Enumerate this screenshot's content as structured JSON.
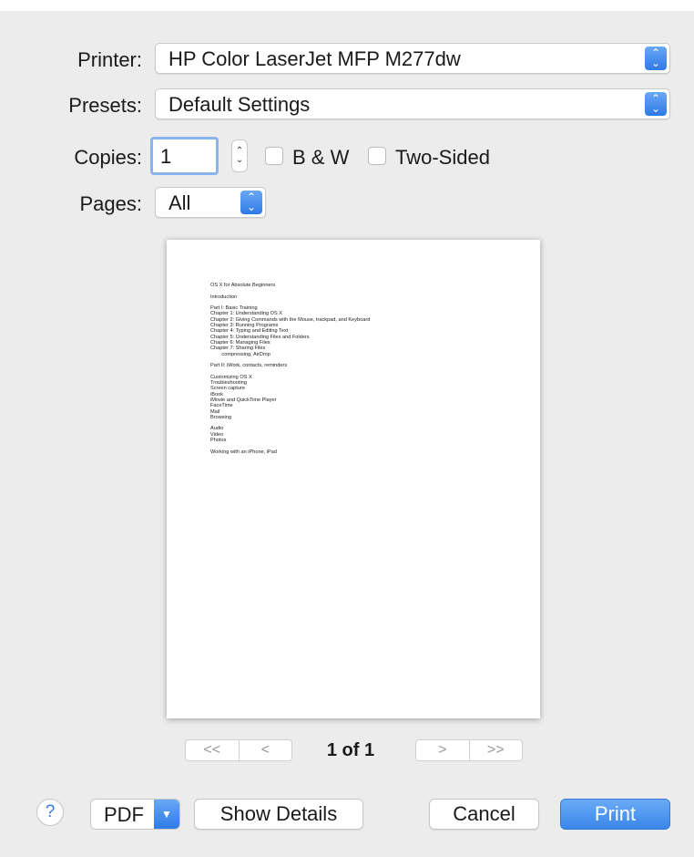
{
  "printer": {
    "label": "Printer:",
    "value": "HP Color LaserJet MFP M277dw"
  },
  "presets": {
    "label": "Presets:",
    "value": "Default Settings"
  },
  "copies": {
    "label": "Copies:",
    "value": "1"
  },
  "bw": {
    "label": "B & W",
    "checked": false
  },
  "two_sided": {
    "label": "Two-Sided",
    "checked": false
  },
  "pages": {
    "label": "Pages:",
    "value": "All"
  },
  "preview": {
    "lines": [
      "OS X for Absolute Beginners",
      "",
      "Introduction",
      "",
      "Part I: Basic Training",
      "Chapter 1: Understanding OS X",
      "Chapter 2: Giving Commands with the Mouse, trackpad, and Keyboard",
      "Chapter 3: Running Programs",
      "Chapter 4: Typing and Editing Text",
      "Chapter 5: Understanding Files and Folders",
      "Chapter 6: Managing Files",
      "Chapter 7: Sharing Files",
      "        compressing, AirDrop",
      "",
      "Part II: iWork, contacts, reminders",
      "",
      "Customizing OS X",
      "Troubleshooting",
      "Screen capture",
      "iBook",
      "iMovie and QuickTime Player",
      "FaceTime",
      "Mail",
      "Browsing",
      "",
      "Audio",
      "Video",
      "Photos",
      "",
      "Working with an iPhone, iPad"
    ]
  },
  "nav": {
    "first": "<<",
    "prev": "<",
    "next": ">",
    "last": ">>",
    "page_indicator": "1 of 1"
  },
  "bottom": {
    "help": "?",
    "pdf": "PDF",
    "show_details": "Show Details",
    "cancel": "Cancel",
    "print": "Print"
  },
  "icons": {
    "popup_arrows": "updown-chevron-icon",
    "pdf_menu": "chevron-down-icon"
  },
  "colors": {
    "accent": "#2f7ae6",
    "background": "#ececec"
  }
}
